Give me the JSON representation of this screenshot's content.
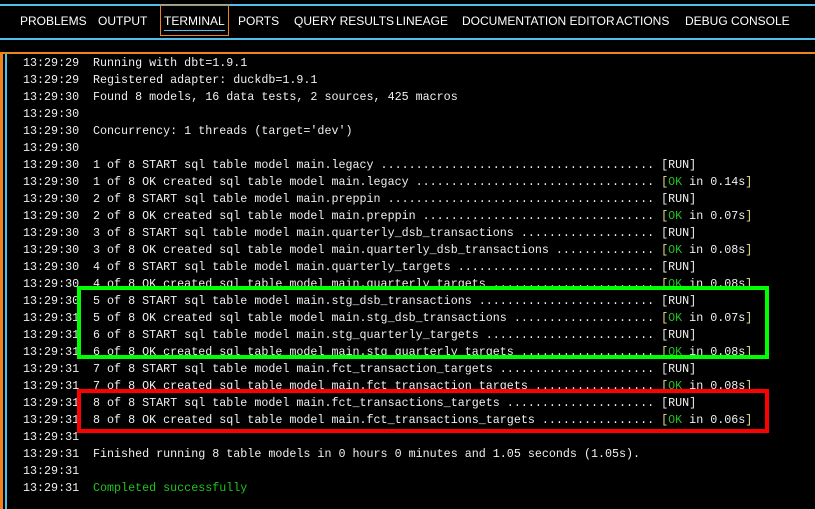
{
  "tabs": [
    {
      "label": "PROBLEMS"
    },
    {
      "label": "OUTPUT"
    },
    {
      "label": "TERMINAL",
      "active": true
    },
    {
      "label": "PORTS"
    },
    {
      "label": "QUERY RESULTS"
    },
    {
      "label": "LINEAGE"
    },
    {
      "label": "DOCUMENTATION EDITOR"
    },
    {
      "label": "ACTIONS"
    },
    {
      "label": "DEBUG CONSOLE"
    }
  ],
  "terminal": {
    "lines": [
      {
        "ts": "13:29:29",
        "text": "Running with dbt=1.9.1"
      },
      {
        "ts": "13:29:29",
        "text": "Registered adapter: duckdb=1.9.1"
      },
      {
        "ts": "13:29:30",
        "text": "Found 8 models, 16 data tests, 2 sources, 425 macros"
      },
      {
        "ts": "13:29:30",
        "text": ""
      },
      {
        "ts": "13:29:30",
        "text": "Concurrency: 1 threads (target='dev')"
      },
      {
        "ts": "13:29:30",
        "text": ""
      },
      {
        "ts": "13:29:30",
        "text": "1 of 8 START sql table model main.legacy",
        "status": "RUN"
      },
      {
        "ts": "13:29:30",
        "text": "1 of 8 OK created sql table model main.legacy",
        "ok": "OK",
        "time": " in 0.14s"
      },
      {
        "ts": "13:29:30",
        "text": "2 of 8 START sql table model main.preppin",
        "status": "RUN"
      },
      {
        "ts": "13:29:30",
        "text": "2 of 8 OK created sql table model main.preppin",
        "ok": "OK",
        "time": " in 0.07s"
      },
      {
        "ts": "13:29:30",
        "text": "3 of 8 START sql table model main.quarterly_dsb_transactions",
        "status": "RUN"
      },
      {
        "ts": "13:29:30",
        "text": "3 of 8 OK created sql table model main.quarterly_dsb_transactions",
        "ok": "OK",
        "time": " in 0.08s"
      },
      {
        "ts": "13:29:30",
        "text": "4 of 8 START sql table model main.quarterly_targets",
        "status": "RUN"
      },
      {
        "ts": "13:29:30",
        "text": "4 of 8 OK created sql table model main.quarterly_targets",
        "ok": "OK",
        "time": " in 0.08s"
      },
      {
        "ts": "13:29:30",
        "text": "5 of 8 START sql table model main.stg_dsb_transactions",
        "status": "RUN"
      },
      {
        "ts": "13:29:31",
        "text": "5 of 8 OK created sql table model main.stg_dsb_transactions",
        "ok": "OK",
        "time": " in 0.07s"
      },
      {
        "ts": "13:29:31",
        "text": "6 of 8 START sql table model main.stg_quarterly_targets",
        "status": "RUN"
      },
      {
        "ts": "13:29:31",
        "text": "6 of 8 OK created sql table model main.stg_quarterly_targets",
        "ok": "OK",
        "time": " in 0.08s"
      },
      {
        "ts": "13:29:31",
        "text": "7 of 8 START sql table model main.fct_transaction_targets",
        "status": "RUN"
      },
      {
        "ts": "13:29:31",
        "text": "7 of 8 OK created sql table model main.fct_transaction_targets",
        "ok": "OK",
        "time": " in 0.08s"
      },
      {
        "ts": "13:29:31",
        "text": "8 of 8 START sql table model main.fct_transactions_targets",
        "status": "RUN"
      },
      {
        "ts": "13:29:31",
        "text": "8 of 8 OK created sql table model main.fct_transactions_targets",
        "ok": "OK",
        "time": " in 0.06s"
      },
      {
        "ts": "13:29:31",
        "text": ""
      },
      {
        "ts": "13:29:31",
        "text": "Finished running 8 table models in 0 hours 0 minutes and 1.05 seconds (1.05s)."
      },
      {
        "ts": "13:29:31",
        "text": ""
      },
      {
        "ts": "13:29:31",
        "text": "Completed successfully",
        "success": true
      }
    ]
  },
  "colors": {
    "highlight_green": "#00ff00",
    "highlight_red": "#ff0000",
    "accent": "#f0821e",
    "border_blue": "#4fc1e9"
  }
}
